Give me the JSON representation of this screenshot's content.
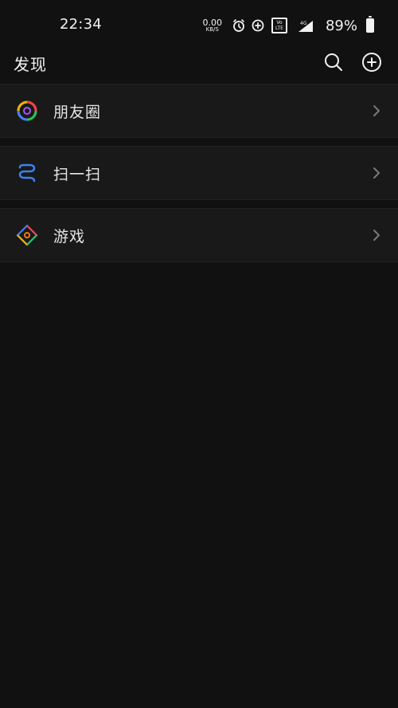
{
  "status_bar": {
    "time": "22:34",
    "net_speed_value": "0.00",
    "net_speed_unit": "KB/S",
    "volte_top": "Vo",
    "volte_bottom": "LTE",
    "network": "4G",
    "battery": "89%"
  },
  "header": {
    "title": "发现",
    "icons": [
      "search-icon",
      "add-circle-icon"
    ]
  },
  "menu": {
    "items": [
      {
        "label": "朋友圈",
        "icon": "moments-icon"
      },
      {
        "label": "扫一扫",
        "icon": "scan-icon"
      },
      {
        "label": "游戏",
        "icon": "games-icon"
      }
    ]
  },
  "colors": {
    "background": "#111111",
    "row_background": "#191919",
    "text": "#e6e6e6",
    "chevron": "#7a7a7a",
    "accent_blue": "#3b82f6"
  }
}
